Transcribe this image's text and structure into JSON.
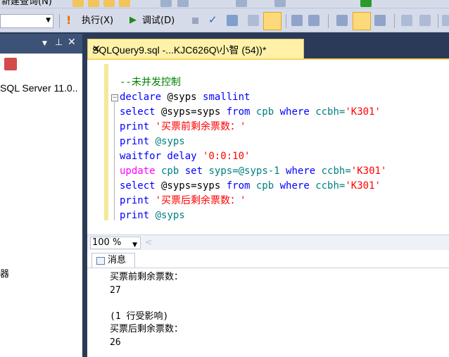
{
  "menu": {
    "partial_label": "新建查询(N)"
  },
  "toolbar": {
    "execute_label": "执行(X)",
    "debug_label": "调试(D)",
    "db_combo_value": ""
  },
  "object_explorer": {
    "server_label": "SQL Server 11.0..",
    "partial_item": "器"
  },
  "editor": {
    "tab_title": "SQLQuery9.sql -...KJC626Q\\小智 (54))*",
    "close_glyph": "✕",
    "lines": {
      "l1": "--未并发控制",
      "l2_kw": "declare",
      "l2_rest": " @syps ",
      "l2_type": "smallint",
      "l3_kw": "select",
      "l3_mid": " @syps=syps ",
      "l3_from": "from",
      "l3_tbl": " cpb ",
      "l3_where": "where",
      "l3_col": " ccbh=",
      "l3_str": "'K301'",
      "l4_kw": "print",
      "l4_str": " '买票前剩余票数：'",
      "l5_kw": "print",
      "l5_var": " @syps",
      "l6_kw": "waitfor delay",
      "l6_str": " '0:0:10'",
      "l7_kw": "update",
      "l7_tbl": " cpb ",
      "l7_set": "set",
      "l7_mid": " syps=@syps-1 ",
      "l7_where": "where",
      "l7_col": " ccbh=",
      "l7_str": "'K301'",
      "l8_kw": "select",
      "l8_mid": " @syps=syps ",
      "l8_from": "from",
      "l8_tbl": " cpb ",
      "l8_where": "where",
      "l8_col": " ccbh=",
      "l8_str": "'K301'",
      "l9_kw": "print",
      "l9_str": " '买票后剩余票数：'",
      "l10_kw": "print",
      "l10_var": " @syps"
    },
    "zoom": "100 %"
  },
  "results": {
    "tab_label": "消息",
    "messages": [
      "买票前剩余票数：",
      "27",
      "",
      "(1 行受影响)",
      "买票后剩余票数：",
      "26"
    ]
  },
  "colors": {
    "keyword": "#0000ff",
    "string": "#ff0000",
    "comment": "#008000",
    "update_keyword": "#ff00ff",
    "tab_active": "#fff2a8"
  }
}
